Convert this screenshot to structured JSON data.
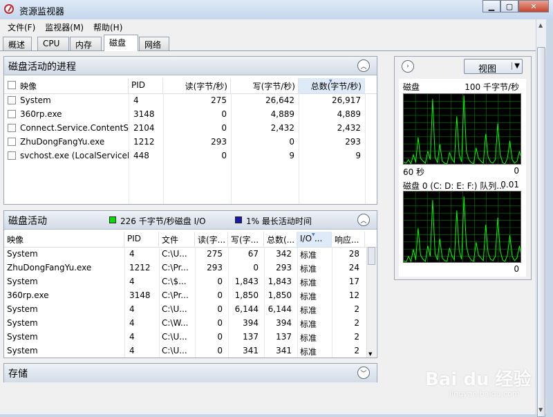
{
  "window": {
    "title": "资源监视器"
  },
  "menu": [
    "文件(F)",
    "监视器(M)",
    "帮助(H)"
  ],
  "tabs": [
    "概述",
    "CPU",
    "内存",
    "磁盘",
    "网络"
  ],
  "processes": {
    "title": "磁盘活动的进程",
    "columns": [
      "映像",
      "PID",
      "读(字节/秒)",
      "写(字节/秒)",
      "总数(字节/秒)"
    ],
    "rows": [
      [
        "System",
        "4",
        "275",
        "26,642",
        "26,917"
      ],
      [
        "360rp.exe",
        "3148",
        "0",
        "4,889",
        "4,889"
      ],
      [
        "Connect.Service.ContentSer...",
        "2104",
        "0",
        "2,432",
        "2,432"
      ],
      [
        "ZhuDongFangYu.exe",
        "1212",
        "293",
        "0",
        "293"
      ],
      [
        "svchost.exe (LocalServiceN...",
        "448",
        "0",
        "9",
        "9"
      ]
    ]
  },
  "activity": {
    "title": "磁盘活动",
    "io_label": "226 千字节/秒磁盘 I/O",
    "active_label": "1% 最长活动时间",
    "io_color": "#00e000",
    "active_color": "#1a1aa8",
    "columns": [
      "映像",
      "PID",
      "文件",
      "读(字...",
      "写(字...",
      "总数(...",
      "I/O ...",
      "响应..."
    ],
    "rows": [
      [
        "System",
        "4",
        "C:\\U...",
        "275",
        "67",
        "342",
        "标准",
        "28"
      ],
      [
        "ZhuDongFangYu.exe",
        "1212",
        "C:\\Pr...",
        "293",
        "0",
        "293",
        "标准",
        "24"
      ],
      [
        "System",
        "4",
        "C:\\$...",
        "0",
        "1,843",
        "1,843",
        "标准",
        "17"
      ],
      [
        "360rp.exe",
        "3148",
        "C:\\Pr...",
        "0",
        "1,850",
        "1,850",
        "标准",
        "12"
      ],
      [
        "System",
        "4",
        "C:\\U...",
        "0",
        "6,144",
        "6,144",
        "标准",
        "2"
      ],
      [
        "System",
        "4",
        "C:\\W...",
        "0",
        "394",
        "394",
        "标准",
        "2"
      ],
      [
        "System",
        "4",
        "C:\\U...",
        "0",
        "137",
        "137",
        "标准",
        "2"
      ],
      [
        "System",
        "4",
        "C:\\U...",
        "0",
        "341",
        "341",
        "标准",
        "2"
      ]
    ]
  },
  "storage": {
    "title": "存储"
  },
  "side": {
    "view_label": "视图",
    "graph1": {
      "title": "磁盘",
      "scale": "100 千字节/秒",
      "time": "60 秒",
      "min": "0",
      "values": [
        5,
        3,
        8,
        2,
        15,
        4,
        40,
        10,
        6,
        3,
        20,
        8,
        95,
        12,
        4,
        30,
        6,
        3,
        2,
        18,
        9,
        4,
        70,
        15,
        5,
        100,
        20,
        8,
        4,
        2,
        25,
        10,
        6,
        3,
        45,
        12,
        5,
        3,
        8,
        60,
        15,
        4,
        2,
        10,
        35,
        8,
        3,
        6,
        20,
        5
      ]
    },
    "graph2": {
      "title": "磁盘 0 (C: D: E: F:) 队列...",
      "scale": "0.01",
      "min": "0",
      "values": [
        4,
        2,
        10,
        3,
        20,
        5,
        50,
        12,
        6,
        3,
        25,
        10,
        90,
        14,
        5,
        35,
        8,
        4,
        3,
        22,
        11,
        5,
        75,
        18,
        6,
        95,
        25,
        10,
        5,
        3,
        30,
        12,
        8,
        4,
        55,
        15,
        6,
        4,
        10,
        65,
        18,
        5,
        3,
        12,
        40,
        10,
        4,
        8,
        25,
        6
      ]
    }
  },
  "watermark": {
    "brand": "Bai du 经验",
    "url": "jingyan.baidu.com"
  }
}
